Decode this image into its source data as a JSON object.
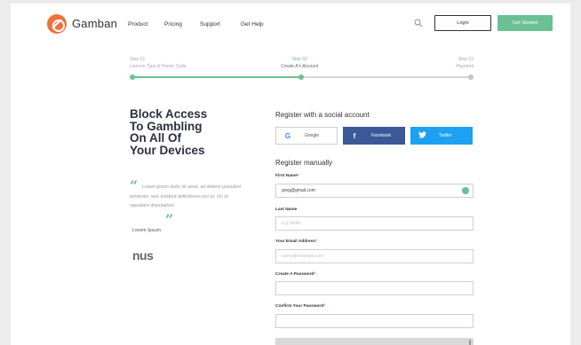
{
  "header": {
    "logo_text": "Gamban",
    "nav": [
      "Product",
      "Pricing",
      "Support",
      "Get Help"
    ],
    "login_label": "Login",
    "started_label": "Get Started"
  },
  "steps": [
    {
      "title": "Step 01",
      "desc": "Licence Type & Promo Code"
    },
    {
      "title": "Step 02",
      "desc": "Create A's Account"
    },
    {
      "title": "Step 03",
      "desc": "Payment"
    }
  ],
  "hero": {
    "headline": [
      "Block Access",
      "To Gambling",
      "On All Of",
      "Your Devices"
    ],
    "quote": "Lorem ipsum dolor sit amet, ad debent postulant tendentor sed, invidunt definitiones pro at. Vis id repudiare disputationi.",
    "author": "Lorem Ipsum",
    "brand": "nus"
  },
  "social": {
    "title": "Register with a social account",
    "google": "Google",
    "facebook": "Facebook",
    "twitter": "Twitter"
  },
  "manual": {
    "title": "Register manually",
    "first_name_label": "First Name",
    "first_name_value": "greg@gmail.com",
    "last_name_label": "Last Name",
    "last_name_placeholder": "e.g Smith",
    "email_label": "Your Email Address",
    "email_placeholder": "name@example.com",
    "password_label": "Create A Password",
    "confirm_label": "Confirm Your Password"
  },
  "colors": {
    "accent": "#6bc094",
    "brand": "#f0713a",
    "facebook": "#3b5998",
    "twitter": "#1da1f2"
  }
}
